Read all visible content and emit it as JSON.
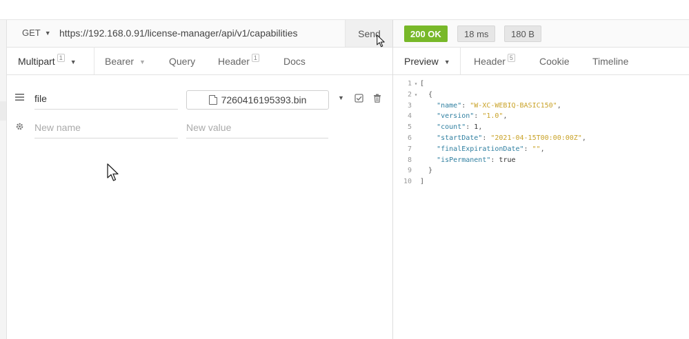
{
  "request": {
    "method": "GET",
    "url": "https://192.168.0.91/license-manager/api/v1/capabilities",
    "send_label": "Send",
    "tabs": [
      {
        "label": "Multipart",
        "count": "1"
      },
      {
        "label": "Bearer"
      },
      {
        "label": "Query"
      },
      {
        "label": "Header",
        "count": "1"
      },
      {
        "label": "Docs"
      }
    ],
    "params": {
      "row1": {
        "name": "file",
        "file_name": "7260416195393.bin"
      },
      "row2": {
        "name_placeholder": "New name",
        "value_placeholder": "New value"
      }
    }
  },
  "response": {
    "status": "200 OK",
    "time": "18 ms",
    "size": "180 B",
    "tabs": [
      {
        "label": "Preview"
      },
      {
        "label": "Header",
        "count": "5"
      },
      {
        "label": "Cookie"
      },
      {
        "label": "Timeline"
      }
    ],
    "body": {
      "name_key": "\"name\"",
      "name_val": "\"W-XC-WEBIQ-BASIC150\"",
      "version_key": "\"version\"",
      "version_val": "\"1.0\"",
      "count_key": "\"count\"",
      "count_val": "1",
      "startDate_key": "\"startDate\"",
      "startDate_val": "\"2021-04-15T00:00:00Z\"",
      "finalExpirationDate_key": "\"finalExpirationDate\"",
      "finalExpirationDate_val": "\"\"",
      "isPermanent_key": "\"isPermanent\"",
      "isPermanent_val": "true"
    }
  },
  "icons": {
    "method_caret": "chevron-down-icon",
    "row_handle": "drag-handle-icon",
    "row_settings": "gear-icon",
    "file": "file-icon",
    "value_dropdown": "chevron-down-icon",
    "checkbox": "checkbox-icon",
    "delete": "trash-icon"
  }
}
